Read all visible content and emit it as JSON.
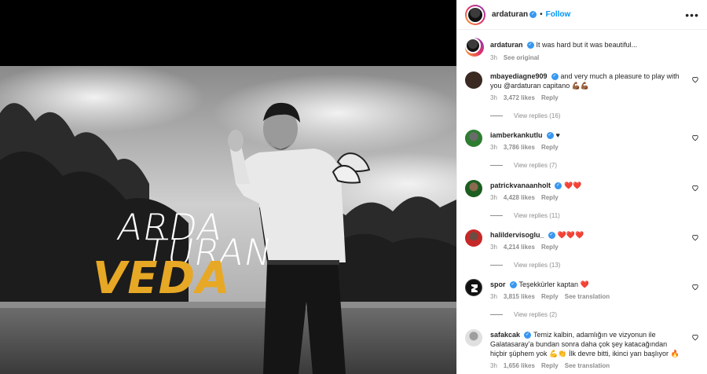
{
  "post": {
    "author": "ardaturan",
    "follow_label": "Follow",
    "more_label": "•••",
    "caption": "It was hard but it was beautiful...",
    "caption_time": "3h",
    "see_original_label": "See original",
    "overlay": {
      "line1": "ARDA",
      "line2": "TURAN",
      "line3": "VEDA"
    }
  },
  "comments": [
    {
      "user": "mbayediagne909",
      "text": "and very much a pleasure to play with you @ardaturan capitano 💪🏾💪🏾",
      "time": "3h",
      "likes": "3,472 likes",
      "reply": "Reply",
      "view_replies": "View replies (16)"
    },
    {
      "user": "iamberkankutlu",
      "text": "♥",
      "time": "3h",
      "likes": "3,786 likes",
      "reply": "Reply",
      "view_replies": "View replies (7)"
    },
    {
      "user": "patrickvanaanholt",
      "text": "❤️❤️",
      "time": "3h",
      "likes": "4,428 likes",
      "reply": "Reply",
      "view_replies": "View replies (11)"
    },
    {
      "user": "halildervisoglu_",
      "text": "❤️❤️❤️",
      "time": "3h",
      "likes": "4,214 likes",
      "reply": "Reply",
      "view_replies": "View replies (13)"
    },
    {
      "user": "spor",
      "text": "Teşekkürler kaptan ❤️",
      "time": "3h",
      "likes": "3,815 likes",
      "reply": "Reply",
      "see_translation": "See translation",
      "view_replies": "View replies (2)"
    },
    {
      "user": "safakcak",
      "text": "Temiz kalbin, adamlığın ve vizyonun ile Galatasaray’a bundan sonra daha çok şey katacağından hiçbir şüphem yok 💪👏 İlk devre bitti, ikinci yarı başlıyor 🔥",
      "time": "3h",
      "likes": "1,656 likes",
      "reply": "Reply",
      "see_translation": "See translation"
    }
  ],
  "icons": {
    "verified": "verified-badge-icon",
    "heart": "heart-outline-icon",
    "more": "more-horizontal-icon"
  },
  "colors": {
    "accent_blue": "#0095f6",
    "veda_gold": "#e7a825",
    "heart_red": "#ed4956",
    "meta_gray": "#8e8e8e"
  }
}
